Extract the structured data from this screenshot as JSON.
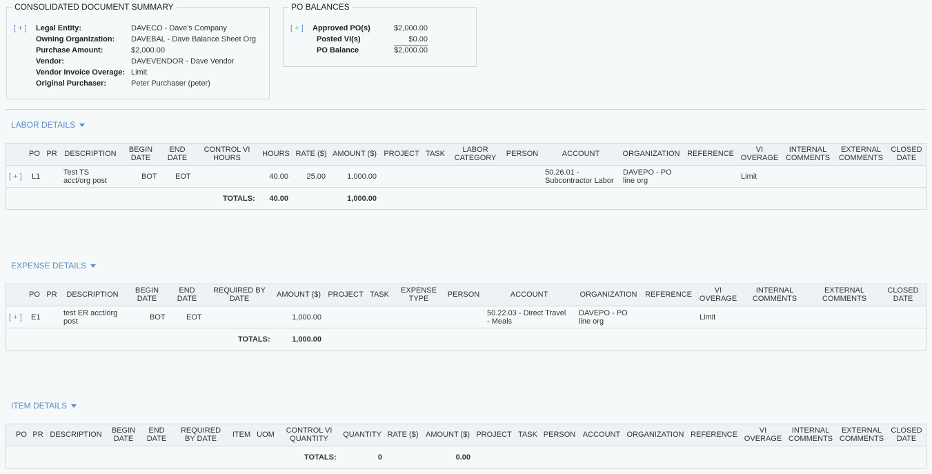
{
  "summary": {
    "title": "CONSOLIDATED DOCUMENT SUMMARY",
    "expand": "[ + ]",
    "rows": [
      {
        "label": "Legal Entity:",
        "value": "DAVECO - Dave's Company"
      },
      {
        "label": "Owning Organization:",
        "value": "DAVEBAL - Dave Balance Sheet Org"
      },
      {
        "label": "Purchase Amount:",
        "value": "$2,000.00"
      },
      {
        "label": "Vendor:",
        "value": "DAVEVENDOR - Dave Vendor"
      },
      {
        "label": "Vendor Invoice Overage:",
        "value": "Limit"
      },
      {
        "label": "Original Purchaser:",
        "value": "Peter Purchaser (peter)"
      }
    ]
  },
  "po_balances": {
    "title": "PO BALANCES",
    "expand": "[ + ]",
    "rows": [
      {
        "label": "Approved PO(s)",
        "value": "$2,000.00"
      },
      {
        "label": "Posted VI(s)",
        "value": "$0.00"
      },
      {
        "label": "PO Balance",
        "value": "$2,000.00"
      }
    ]
  },
  "labor": {
    "section_label": "LABOR DETAILS",
    "headers": [
      "PO",
      "PR",
      "DESCRIPTION",
      "BEGIN\nDATE",
      "END\nDATE",
      "CONTROL VI\nHOURS",
      "HOURS",
      "RATE ($)",
      "AMOUNT ($)",
      "PROJECT",
      "TASK",
      "LABOR\nCATEGORY",
      "PERSON",
      "ACCOUNT",
      "ORGANIZATION",
      "REFERENCE",
      "VI\nOVERAGE",
      "INTERNAL\nCOMMENTS",
      "EXTERNAL\nCOMMENTS",
      "CLOSED\nDATE"
    ],
    "row": {
      "expand": "[ + ]",
      "po": "L1",
      "description": "Test TS\nacct/org post",
      "begin": "BOT",
      "end": "EOT",
      "hours": "40.00",
      "rate": "25.00",
      "amount": "1,000.00",
      "account": "50.26.01 -\nSubcontractor Labor",
      "organization": "DAVEPO - PO\nline org",
      "overage": "Limit"
    },
    "totals": {
      "label": "TOTALS:",
      "hours": "40.00",
      "amount": "1,000.00"
    }
  },
  "expense": {
    "section_label": "EXPENSE DETAILS",
    "headers": [
      "PO",
      "PR",
      "DESCRIPTION",
      "BEGIN\nDATE",
      "END\nDATE",
      "REQUIRED BY\nDATE",
      "AMOUNT ($)",
      "PROJECT",
      "TASK",
      "EXPENSE\nTYPE",
      "PERSON",
      "ACCOUNT",
      "ORGANIZATION",
      "REFERENCE",
      "VI\nOVERAGE",
      "INTERNAL\nCOMMENTS",
      "EXTERNAL\nCOMMENTS",
      "CLOSED\nDATE"
    ],
    "row": {
      "expand": "[ + ]",
      "po": "E1",
      "description": "test ER acct/org\npost",
      "begin": "BOT",
      "end": "EOT",
      "amount": "1,000.00",
      "account": "50.22.03 - Direct Travel\n- Meals",
      "organization": "DAVEPO - PO\nline org",
      "overage": "Limit"
    },
    "totals": {
      "label": "TOTALS:",
      "amount": "1,000.00"
    }
  },
  "item": {
    "section_label": "ITEM DETAILS",
    "headers": [
      "PO",
      "PR",
      "DESCRIPTION",
      "BEGIN\nDATE",
      "END\nDATE",
      "REQUIRED\nBY DATE",
      "ITEM",
      "UOM",
      "CONTROL VI\nQUANTITY",
      "QUANTITY",
      "RATE ($)",
      "AMOUNT ($)",
      "PROJECT",
      "TASK",
      "PERSON",
      "ACCOUNT",
      "ORGANIZATION",
      "REFERENCE",
      "VI\nOVERAGE",
      "INTERNAL\nCOMMENTS",
      "EXTERNAL\nCOMMENTS",
      "CLOSED\nDATE"
    ],
    "totals": {
      "label": "TOTALS:",
      "quantity": "0",
      "amount": "0.00"
    }
  }
}
